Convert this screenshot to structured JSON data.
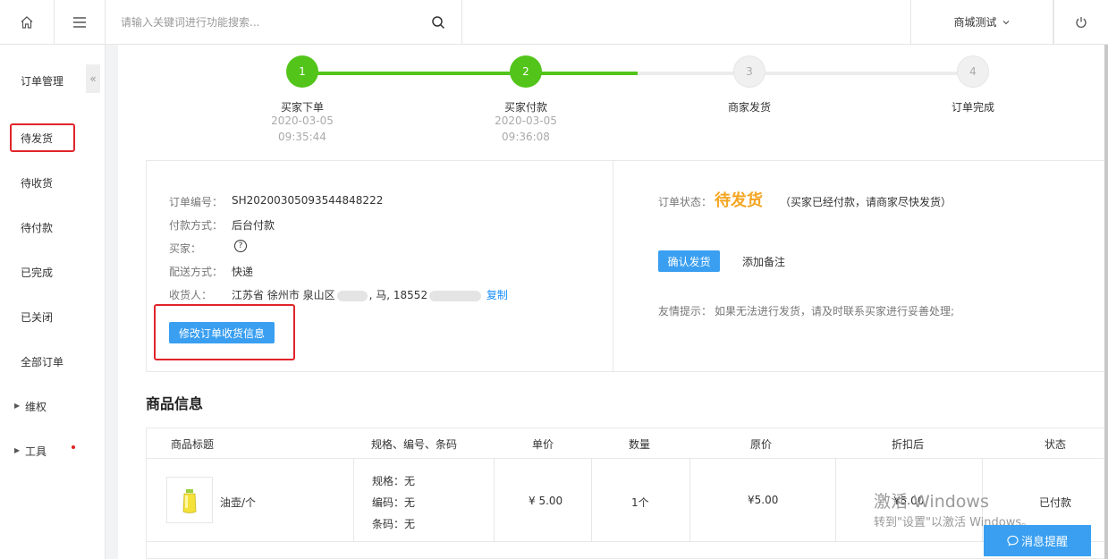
{
  "topbar": {
    "search_placeholder": "请输入关键词进行功能搜索...",
    "user_label": "商城测试"
  },
  "sidebar": {
    "title": "订单管理",
    "collapse_glyph": "«",
    "items": [
      {
        "label": "待发货"
      },
      {
        "label": "待收货"
      },
      {
        "label": "待付款"
      },
      {
        "label": "已完成"
      },
      {
        "label": "已关闭"
      },
      {
        "label": "全部订单"
      },
      {
        "label": "维权"
      },
      {
        "label": "工具"
      }
    ]
  },
  "steps": [
    {
      "num": "1",
      "label": "买家下单",
      "date": "2020-03-05",
      "time": "09:35:44",
      "done": true
    },
    {
      "num": "2",
      "label": "买家付款",
      "date": "2020-03-05",
      "time": "09:36:08",
      "done": true
    },
    {
      "num": "3",
      "label": "商家发货",
      "date": "",
      "time": "",
      "done": false
    },
    {
      "num": "4",
      "label": "订单完成",
      "date": "",
      "time": "",
      "done": false
    }
  ],
  "order": {
    "number_label": "订单编号：",
    "number": "SH20200305093544848222",
    "payment_label": "付款方式：",
    "payment": "后台付款",
    "buyer_label": "买家：",
    "shipping_label": "配送方式：",
    "shipping": "快递",
    "receiver_label": "收货人：",
    "receiver_addr": "江苏省 徐州市 泉山区",
    "receiver_name": ", 马, 18552",
    "copy_link": "复制",
    "edit_button": "修改订单收货信息"
  },
  "status": {
    "label": "订单状态：",
    "value": "待发货",
    "note": "（买家已经付款，请商家尽快发货）",
    "confirm_button": "确认发货",
    "add_remark_link": "添加备注",
    "tip_label": "友情提示：",
    "tip_text": "如果无法进行发货，请及时联系买家进行妥善处理;"
  },
  "goods": {
    "section_title": "商品信息",
    "columns": [
      "商品标题",
      "规格、编号、条码",
      "单价",
      "数量",
      "原价",
      "折扣后",
      "状态"
    ],
    "rows": [
      {
        "title": "油壶/个",
        "spec": "规格：无",
        "code": "编码：无",
        "barcode": "条码：无",
        "unit_price": "¥ 5.00",
        "qty": "1个",
        "orig_price": "¥5.00",
        "discount_price": "¥5.00",
        "status": "已付款"
      }
    ]
  },
  "watermark": {
    "line1": "激活 Windows",
    "line2": "转到\"设置\"以激活 Windows。"
  },
  "notify_button": "消息提醒",
  "colors": {
    "accent_green": "#52c41a",
    "button_blue": "#3a9ff1",
    "status_orange": "#f5a623",
    "highlight_red": "#e0242a"
  }
}
